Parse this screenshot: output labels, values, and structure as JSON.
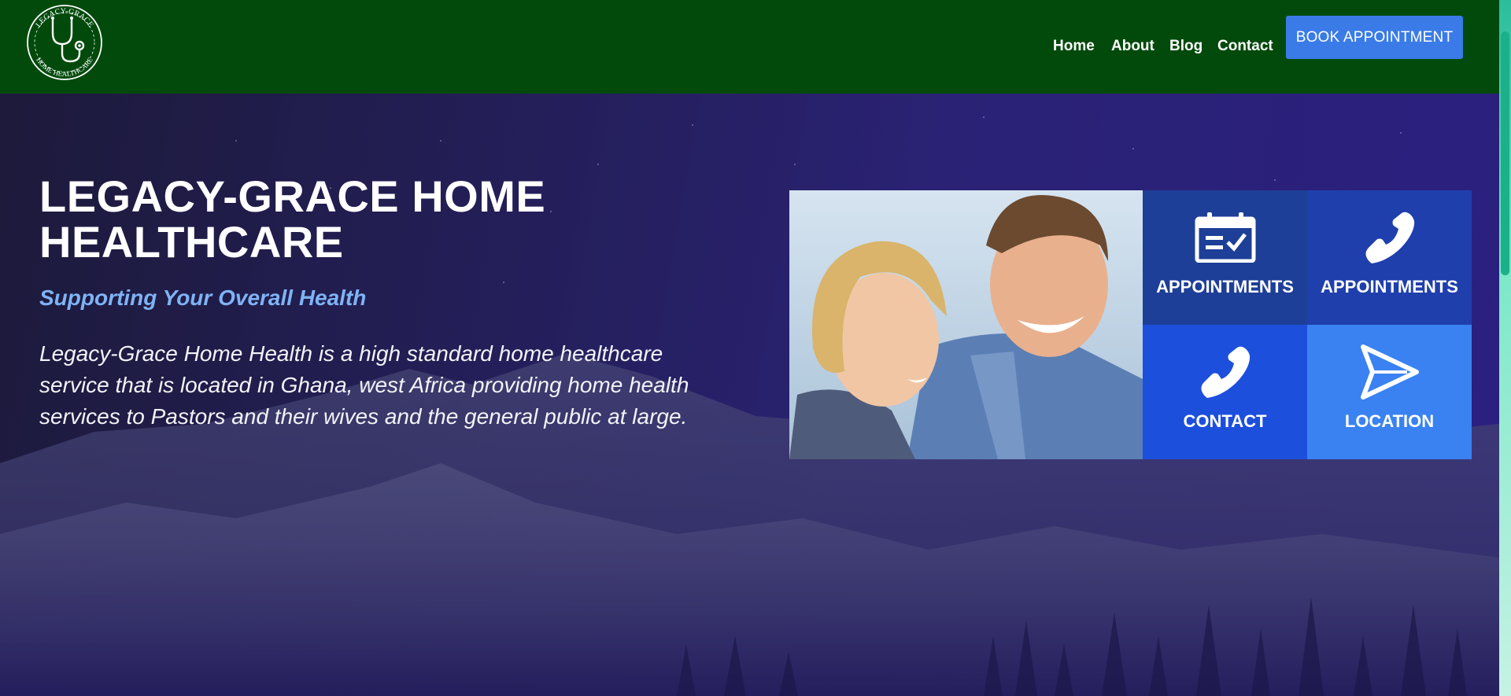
{
  "brand": {
    "logo_top_text": "LEGACY-GRACE",
    "logo_bottom_text": "HOME HEALTHCARE",
    "colors": {
      "header": "#024a0c",
      "accent": "#3a7be8"
    }
  },
  "nav": {
    "items": [
      {
        "label": "Home"
      },
      {
        "label": "About"
      },
      {
        "label": "Blog"
      },
      {
        "label": "Contact"
      }
    ],
    "book_label": "BOOK APPOINTMENT"
  },
  "hero": {
    "title": "LEGACY-GRACE HOME HEALTHCARE",
    "subtitle": "Supporting Your Overall Health",
    "text": "Legacy-Grace Home Health is a high standard home healthcare service that is located in Ghana, west Africa providing home health services to Pastors and their wives and the general public at large."
  },
  "tiles": [
    {
      "label": "APPOINTMENTS",
      "icon": "calendar-check-icon",
      "color": "#1e3f98"
    },
    {
      "label": "APPOINTMENTS",
      "icon": "phone-icon",
      "color": "#1f3fad"
    },
    {
      "label": "CONTACT",
      "icon": "phone-icon",
      "color": "#1d4fdd"
    },
    {
      "label": "LOCATION",
      "icon": "send-icon",
      "color": "#3a82f2"
    }
  ]
}
